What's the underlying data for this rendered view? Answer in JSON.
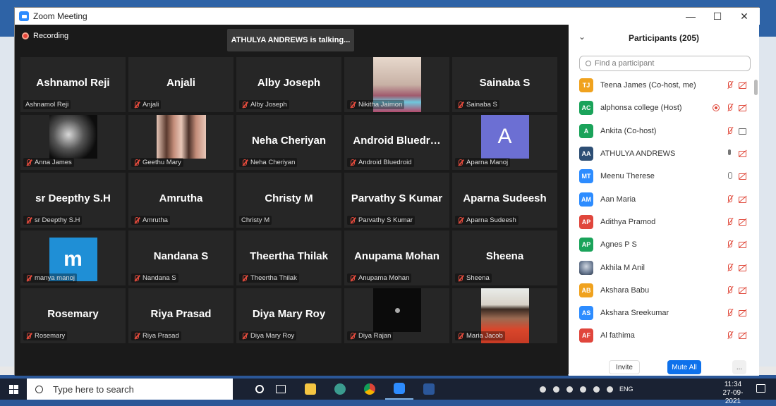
{
  "window": {
    "title": "Zoom Meeting"
  },
  "meeting": {
    "recording_label": "Recording",
    "talking_banner": "ATHULYA ANDREWS is talking..."
  },
  "tiles": [
    {
      "big": "Ashnamol Reji",
      "label": "Ashnamol Reji",
      "muted": false
    },
    {
      "big": "Anjali",
      "label": "Anjali",
      "muted": true
    },
    {
      "big": "Alby Joseph",
      "label": "Alby Joseph",
      "muted": true
    },
    {
      "big": "",
      "label": "Nikitha Jaimon",
      "muted": true,
      "media": "photo"
    },
    {
      "big": "Sainaba S",
      "label": "Sainaba S",
      "muted": true
    },
    {
      "big": "",
      "label": "Anna James",
      "muted": true,
      "media": "photo"
    },
    {
      "big": "",
      "label": "Geethu Mary",
      "muted": true,
      "media": "photo"
    },
    {
      "big": "Neha Cheriyan",
      "label": "Neha Cheriyan",
      "muted": true
    },
    {
      "big": "Android  Bluedr…",
      "label": "Android Bluedroid",
      "muted": true
    },
    {
      "big": "",
      "label": "Aparna Manoj",
      "muted": true,
      "avatar_letter": "A"
    },
    {
      "big": "sr Deepthy S.H",
      "label": "sr Deepthy S.H",
      "muted": true
    },
    {
      "big": "Amrutha",
      "label": "Amrutha",
      "muted": true
    },
    {
      "big": "Christy M",
      "label": "Christy M",
      "muted": false
    },
    {
      "big": "Parvathy S Kumar",
      "label": "Parvathy S Kumar",
      "muted": true
    },
    {
      "big": "Aparna Sudeesh",
      "label": "Aparna Sudeesh",
      "muted": true
    },
    {
      "big": "",
      "label": "manya manoj",
      "muted": true,
      "avatar_letter": "m"
    },
    {
      "big": "Nandana S",
      "label": "Nandana S",
      "muted": true
    },
    {
      "big": "Theertha Thilak",
      "label": "Theertha Thilak",
      "muted": true
    },
    {
      "big": "Anupama Mohan",
      "label": "Anupama Mohan",
      "muted": true
    },
    {
      "big": "Sheena",
      "label": "Sheena",
      "muted": true
    },
    {
      "big": "Rosemary",
      "label": "Rosemary",
      "muted": true
    },
    {
      "big": "Riya Prasad",
      "label": "Riya Prasad",
      "muted": true
    },
    {
      "big": "Diya Mary Roy",
      "label": "Diya Mary Roy",
      "muted": true
    },
    {
      "big": "",
      "label": "Diya Rajan",
      "muted": true,
      "media": "photo"
    },
    {
      "big": "",
      "label": "Maria Jacob",
      "muted": true,
      "media": "photo"
    }
  ],
  "participants_panel": {
    "title": "Participants (205)",
    "search_placeholder": "Find a participant",
    "participants": [
      {
        "initials": "TJ",
        "name": "Teena James (Co-host, me)",
        "color": "#f0a21e",
        "mic": "muted",
        "video": "off"
      },
      {
        "initials": "AC",
        "name": "alphonsa college (Host)",
        "color": "#1aa35a",
        "mic": "muted",
        "video": "off",
        "recording": true
      },
      {
        "initials": "A",
        "name": "Ankita (Co-host)",
        "color": "#1aa35a",
        "mic": "muted",
        "video": "on"
      },
      {
        "initials": "AA",
        "name": "ATHULYA ANDREWS",
        "color": "#2d4e74",
        "mic": "on",
        "video": "off"
      },
      {
        "initials": "MT",
        "name": "Meenu Therese",
        "color": "#2d8cff",
        "mic": "idle",
        "video": "off"
      },
      {
        "initials": "AM",
        "name": "Aan Maria",
        "color": "#2d8cff",
        "mic": "muted",
        "video": "off"
      },
      {
        "initials": "AP",
        "name": "Adithya Pramod",
        "color": "#e0463c",
        "mic": "muted",
        "video": "off"
      },
      {
        "initials": "AP",
        "name": "Agnes P S",
        "color": "#1aa35a",
        "mic": "muted",
        "video": "off"
      },
      {
        "initials": "",
        "name": "Akhila M Anil",
        "color": "#7a8ba3",
        "mic": "muted",
        "video": "off",
        "photo": true
      },
      {
        "initials": "AB",
        "name": "Akshara Babu",
        "color": "#f0a21e",
        "mic": "muted",
        "video": "off"
      },
      {
        "initials": "AS",
        "name": "Akshara Sreekumar",
        "color": "#2d8cff",
        "mic": "muted",
        "video": "off"
      },
      {
        "initials": "AF",
        "name": "Al fathima",
        "color": "#e0463c",
        "mic": "muted",
        "video": "off"
      }
    ],
    "invite_label": "Invite",
    "mute_all_label": "Mute All",
    "more_label": "..."
  },
  "taskbar": {
    "search_placeholder": "Type here to search",
    "tray_lang": "ENG",
    "time": "11:34",
    "date": "27-09-2021"
  }
}
